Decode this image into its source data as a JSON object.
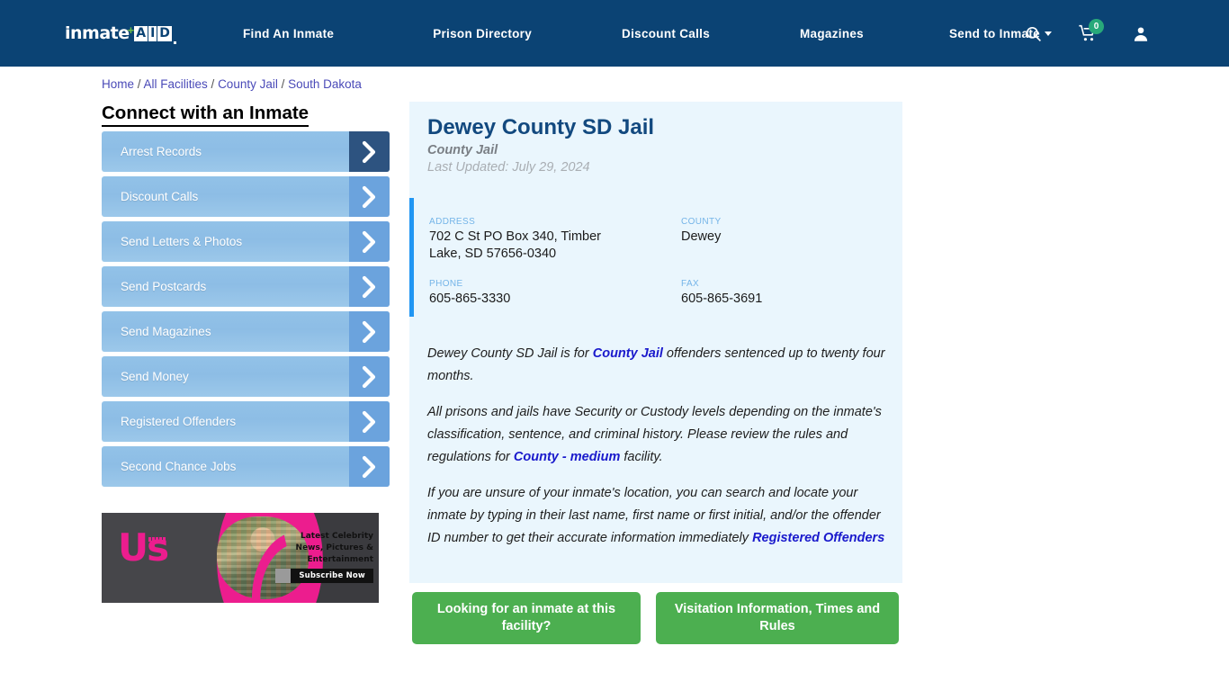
{
  "brand": {
    "word": "inmate",
    "plus": "+",
    "aid_letters": [
      "A",
      "I",
      "D"
    ]
  },
  "nav": {
    "links": [
      {
        "label": "Find An Inmate"
      },
      {
        "label": "Prison Directory"
      },
      {
        "label": "Discount Calls"
      },
      {
        "label": "Magazines"
      },
      {
        "label": "Send to Inmate"
      }
    ],
    "icons": {
      "search": "search-icon",
      "cart": "cart-icon",
      "user": "user-icon"
    },
    "cart_count": "0",
    "cart_badge_color": "#28a97a",
    "navbar_color": "#0b4374"
  },
  "breadcrumb": {
    "items": [
      {
        "label": "Home"
      },
      {
        "label": "All Facilities"
      },
      {
        "label": "County Jail"
      },
      {
        "label": "South Dakota"
      }
    ],
    "separator": " / "
  },
  "sidebar": {
    "title": "Connect with an Inmate",
    "items": [
      {
        "label": "Arrest Records",
        "active": true
      },
      {
        "label": "Discount Calls",
        "active": false
      },
      {
        "label": "Send Letters & Photos",
        "active": false
      },
      {
        "label": "Send Postcards",
        "active": false
      },
      {
        "label": "Send Magazines",
        "active": false
      },
      {
        "label": "Send Money",
        "active": false
      },
      {
        "label": "Registered Offenders",
        "active": false
      },
      {
        "label": "Second Chance Jobs",
        "active": false
      }
    ]
  },
  "ad": {
    "logo": "Us",
    "headline": "Latest Celebrity News, Pictures & Entertainment",
    "cta": "Subscribe Now"
  },
  "facility": {
    "name": "Dewey County SD Jail",
    "type": "County Jail",
    "last_updated": "Last Updated: July 29, 2024",
    "accent_color": "#2196f3",
    "fields": {
      "address_label": "ADDRESS",
      "address_value": "702 C St PO Box 340, Timber Lake, SD 57656-0340",
      "county_label": "COUNTY",
      "county_value": "Dewey",
      "phone_label": "PHONE",
      "phone_value": "605-865-3330",
      "fax_label": "FAX",
      "fax_value": "605-865-3691"
    }
  },
  "body": {
    "p1_a": "Dewey County SD Jail is for ",
    "p1_link": "County Jail",
    "p1_b": " offenders sentenced up to twenty four months.",
    "p2_a": "All prisons and jails have Security or Custody levels depending on the inmate's classification, sentence, and criminal history. Please review the rules and regulations for ",
    "p2_link": "County - medium",
    "p2_b": " facility.",
    "p3_a": "If you are unsure of your inmate's location, you can search and locate your inmate by typing in their last name, first name or first initial, and/or the offender ID number to get their accurate information immediately ",
    "p3_link": "Registered Offenders"
  },
  "cta": {
    "button1": "Looking for an inmate at this facility?",
    "button2": "Visitation Information, Times and Rules",
    "color": "#4caf50"
  }
}
